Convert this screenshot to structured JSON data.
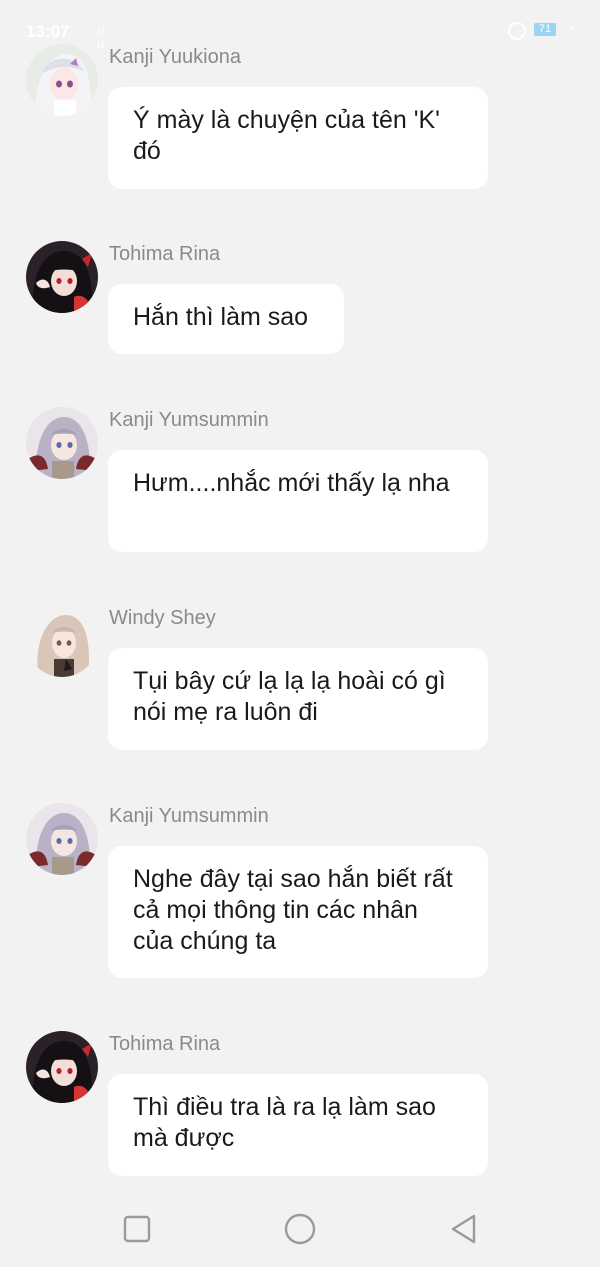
{
  "status_bar": {
    "time": "13:07",
    "signal": "...ıl ...ıl",
    "battery": "71",
    "icons": [
      "signal-icon",
      "wifi-icon",
      "alarm-icon",
      "battery-icon",
      "charging-icon"
    ]
  },
  "messages": [
    {
      "sender": "Kanji Yuukiona",
      "avatar": "white-haired-girl-avatar",
      "text": "Ý mày là chuyện của tên 'K' đó"
    },
    {
      "sender": "Tohima Rina",
      "avatar": "dark-haired-girl-avatar",
      "text": "Hắn thì làm sao"
    },
    {
      "sender": "Kanji Yumsummin",
      "avatar": "silver-haired-girl-avatar",
      "text": "Hưm....nhắc mới thấy lạ nha"
    },
    {
      "sender": "Windy Shey",
      "avatar": "beige-haired-girl-avatar",
      "text": "Tụi bây cứ lạ lạ lạ hoài có gì nói mẹ ra luôn đi"
    },
    {
      "sender": "Kanji Yumsummin",
      "avatar": "silver-haired-girl-avatar",
      "text": "Nghe đây tại sao hắn biết rất cả mọi thông tin các nhân của chúng ta"
    },
    {
      "sender": "Tohima Rina",
      "avatar": "dark-haired-girl-avatar",
      "text": "Thì điều tra là ra lạ làm sao mà được"
    }
  ],
  "nav_bar": {
    "buttons": [
      "recent-apps",
      "home",
      "back"
    ]
  },
  "colors": {
    "background": "#f2f2f2",
    "bubble": "#ffffff",
    "sender": "#8a8a8a",
    "text": "#1a1a1a"
  }
}
